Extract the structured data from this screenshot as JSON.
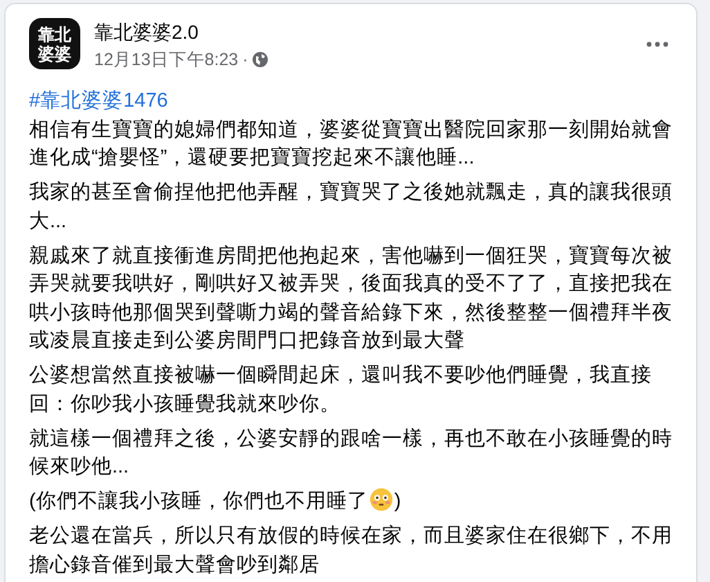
{
  "post": {
    "avatar_text": [
      "靠北",
      "婆婆"
    ],
    "author": "靠北婆婆2.0",
    "timestamp": "12月13日下午8:23",
    "separator": "·",
    "hashtag": "#靠北婆婆1476",
    "paragraphs": [
      {
        "segments": [
          {
            "kind": "text",
            "text": "相信有生寶寶的媳婦們都知道，婆婆從寶寶出醫院回家那一刻開始就會進化成“搶嬰怪”，還硬要把寶寶挖起來不讓他睡..."
          }
        ]
      },
      {
        "segments": [
          {
            "kind": "text",
            "text": "我家的甚至會偷捏他把他弄醒，寶寶哭了之後她就飄走，真的讓我很頭大..."
          }
        ]
      },
      {
        "segments": [
          {
            "kind": "text",
            "text": "親戚來了就直接衝進房間把他抱起來，害他嚇到一個狂哭，寶寶每次被弄哭就要我哄好，剛哄好又被弄哭，後面我真的受不了了，直接把我在哄小孩時他那個哭到聲嘶力竭的聲音給錄下來，然後整整一個禮拜半夜或凌晨直接走到公婆房間門口把錄音放到最大聲"
          }
        ]
      },
      {
        "segments": [
          {
            "kind": "text",
            "text": "公婆想當然直接被嚇一個瞬間起床，還叫我不要吵他們睡覺，我直接回：你吵我小孩睡覺我就來吵你。"
          }
        ]
      },
      {
        "segments": [
          {
            "kind": "text",
            "text": "就這樣一個禮拜之後，公婆安靜的跟啥一樣，再也不敢在小孩睡覺的時候來吵他..."
          }
        ]
      },
      {
        "segments": [
          {
            "kind": "text",
            "text": "(你們不讓我小孩睡，你們也不用睡了"
          },
          {
            "kind": "emoji"
          },
          {
            "kind": "text",
            "text": ")"
          }
        ]
      },
      {
        "segments": [
          {
            "kind": "text",
            "text": "老公還在當兵，所以只有放假的時候在家，而且婆家住在很鄉下，不用擔心錄音催到最大聲會吵到鄰居"
          }
        ]
      }
    ]
  }
}
